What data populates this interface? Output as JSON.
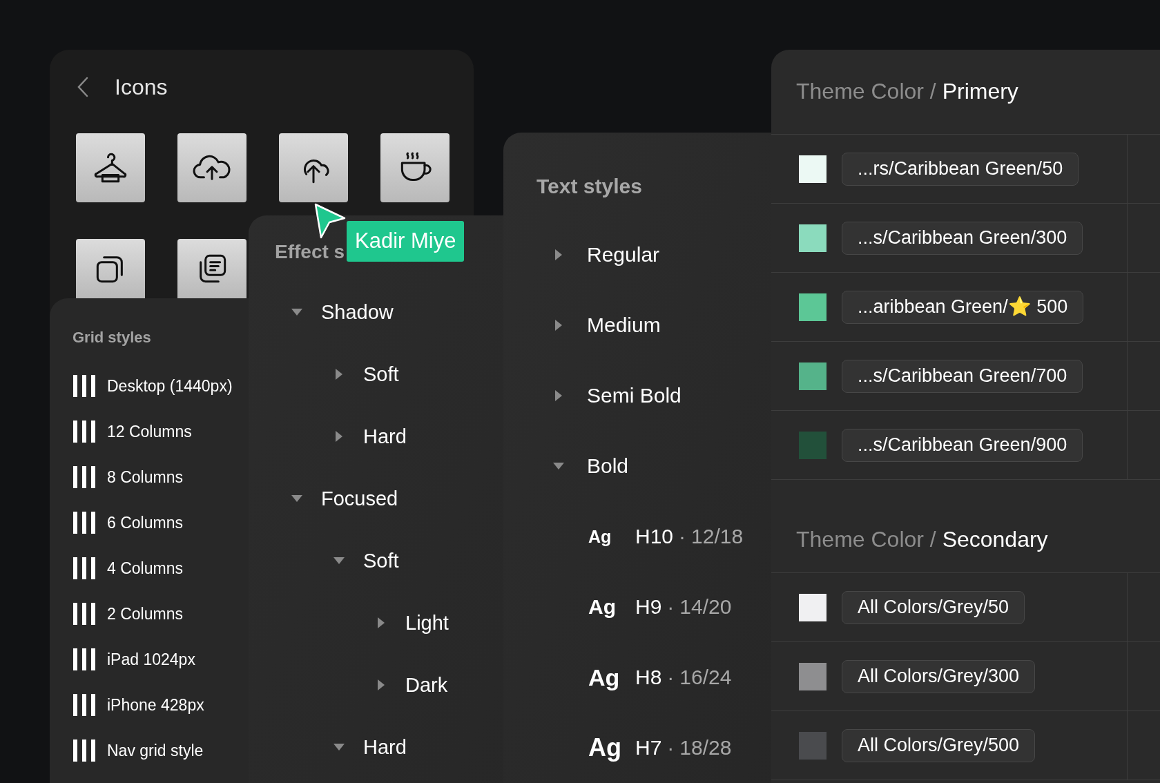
{
  "icons_panel": {
    "title": "Icons",
    "tiles": [
      {
        "kind": "hanger"
      },
      {
        "kind": "cloud"
      },
      {
        "kind": "cloud-round"
      },
      {
        "kind": "cup"
      },
      {
        "kind": "copy"
      },
      {
        "kind": "notes"
      }
    ]
  },
  "grid_styles": {
    "title": "Grid styles",
    "items": [
      "Desktop (1440px)",
      "12 Columns",
      "8 Columns",
      "6 Columns",
      "4 Columns",
      "2 Columns",
      "iPad 1024px",
      "iPhone 428px",
      "Nav grid style"
    ]
  },
  "effect_styles": {
    "title": "Effect s",
    "items": [
      {
        "label": "Shadow",
        "expanded": true,
        "children": [
          {
            "label": "Soft",
            "expanded": false
          },
          {
            "label": "Hard",
            "expanded": false
          }
        ]
      },
      {
        "label": "Focused",
        "expanded": true,
        "children": [
          {
            "label": "Soft",
            "expanded": true,
            "children": [
              {
                "label": "Light",
                "expanded": false
              },
              {
                "label": "Dark",
                "expanded": false
              }
            ]
          },
          {
            "label": "Hard",
            "expanded": true
          }
        ]
      }
    ]
  },
  "text_styles": {
    "title": "Text styles",
    "groups": [
      {
        "label": "Regular",
        "expanded": false
      },
      {
        "label": "Medium",
        "expanded": false
      },
      {
        "label": "Semi Bold",
        "expanded": false
      },
      {
        "label": "Bold",
        "expanded": true,
        "styles": [
          {
            "sample": "Ag",
            "name": "H10",
            "separator": "·",
            "spec": "12/18"
          },
          {
            "sample": "Ag",
            "name": "H9",
            "separator": "·",
            "spec": "14/20"
          },
          {
            "sample": "Ag",
            "name": "H8",
            "separator": "·",
            "spec": "16/24"
          },
          {
            "sample": "Ag",
            "name": "H7",
            "separator": "·",
            "spec": "18/28"
          }
        ]
      }
    ]
  },
  "cursor": {
    "label": "Kadir Miye"
  },
  "theme_colors": [
    {
      "prefix": "Theme Color /",
      "name": "Primery",
      "swatches": [
        {
          "color": "#ecf9f4",
          "label": "...rs/Caribbean Green/50"
        },
        {
          "color": "#8bdbbd",
          "label": "...s/Caribbean Green/300"
        },
        {
          "color": "#5cc796",
          "label": "...aribbean Green/⭐ 500"
        },
        {
          "color": "#55b38a",
          "label": "...s/Caribbean Green/700"
        },
        {
          "color": "#22503a",
          "label": "...s/Caribbean Green/900"
        }
      ]
    },
    {
      "prefix": "Theme Color /",
      "name": "Secondary",
      "swatches": [
        {
          "color": "#f0f0f2",
          "label": "All Colors/Grey/50"
        },
        {
          "color": "#8e8e90",
          "label": "All Colors/Grey/300"
        },
        {
          "color": "#4a4b4e",
          "label": "All Colors/Grey/500"
        }
      ]
    }
  ]
}
